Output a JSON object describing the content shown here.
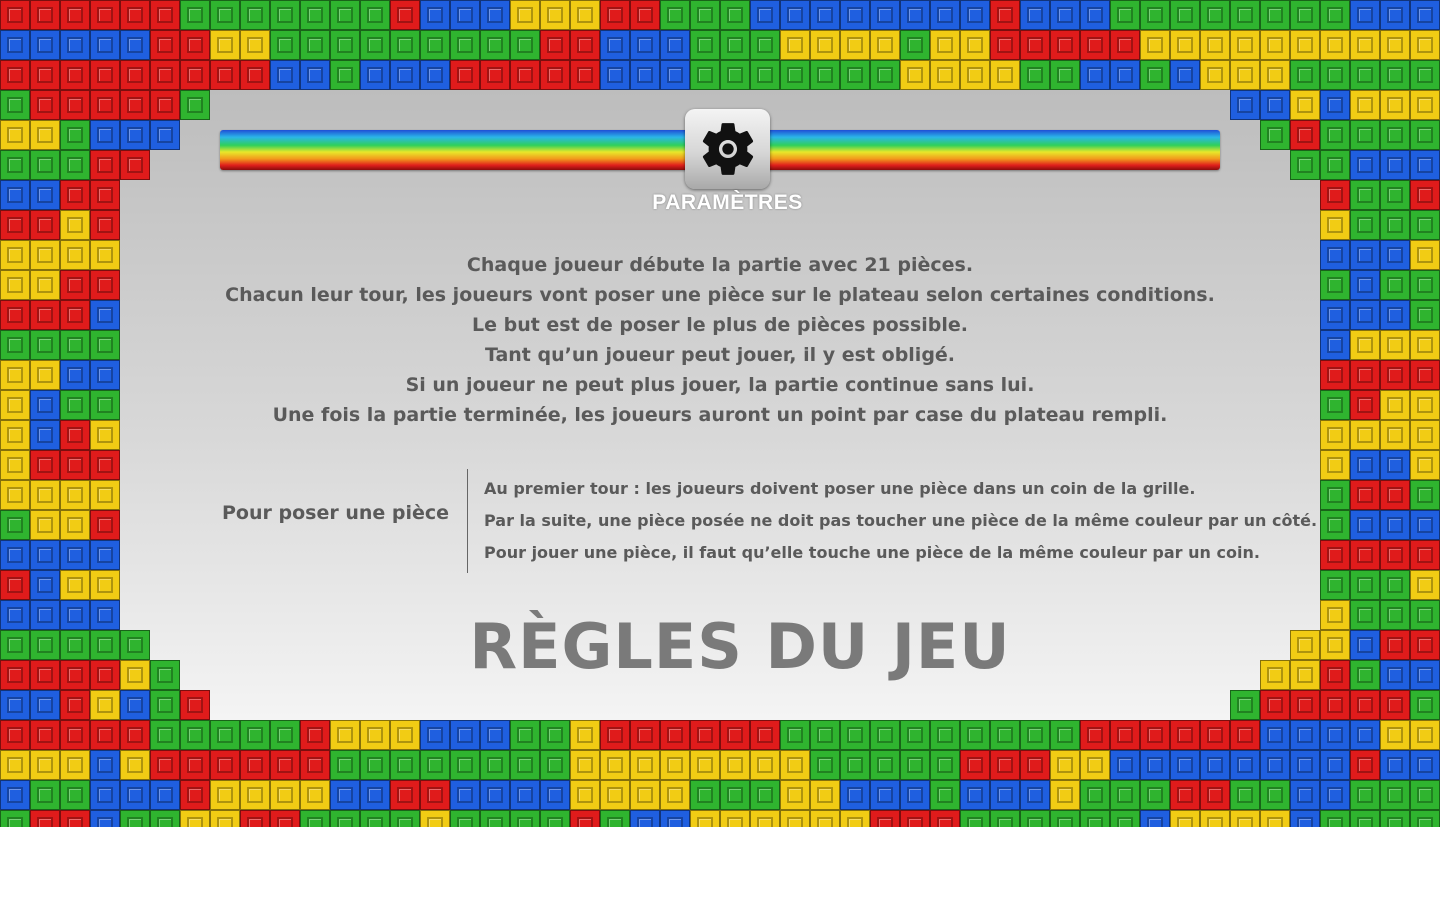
{
  "header": {
    "settings_icon": "gear-icon",
    "settings_label": "PARAMÈTRES"
  },
  "rules": {
    "lines": [
      "Chaque joueur débute la partie avec 21 pièces.",
      "Chacun leur tour, les joueurs vont poser une pièce sur le plateau selon certaines conditions.",
      "Le but est de poser le plus de pièces possible.",
      "Tant qu’un joueur peut jouer, il y est obligé.",
      "Si un joueur ne peut plus jouer, la partie continue sans lui.",
      "Une fois la partie terminée, les joueurs auront un point par case du plateau rempli."
    ]
  },
  "placement": {
    "title": "Pour poser une pièce",
    "rules": [
      "Au premier tour : les joueurs doivent poser une pièce dans un coin de la grille.",
      "Par la suite, une pièce posée ne doit pas toucher une pièce de la même couleur par un côté.",
      "Pour jouer une pièce, il faut qu’elle touche une pièce de la même couleur par un coin."
    ]
  },
  "page_title": "RÈGLES DU JEU",
  "colors": {
    "red": "#e01b1b",
    "blue": "#1f5fe0",
    "green": "#2fb42f",
    "yellow": "#f2cc14",
    "text": "#5a5a5a",
    "heading": "#7a7a7a"
  }
}
